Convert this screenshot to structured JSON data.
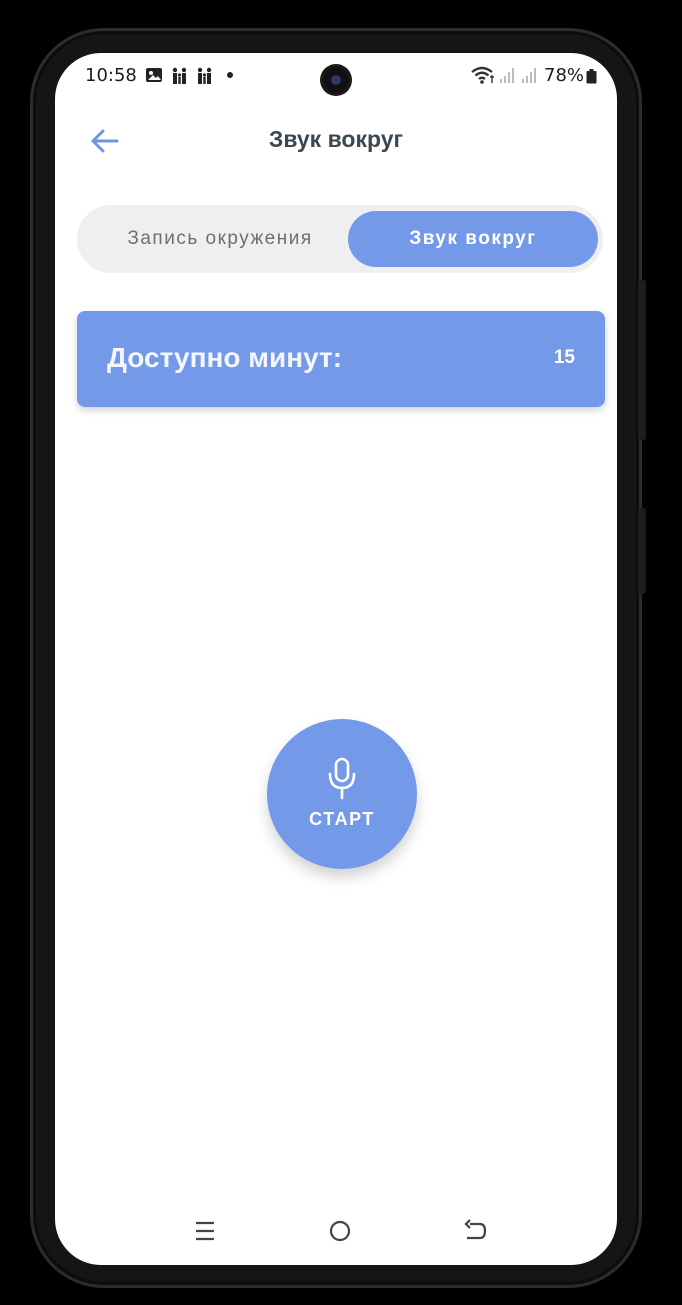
{
  "status_bar": {
    "time": "10:58",
    "battery": "78%",
    "icons": [
      "image-icon",
      "family-icon",
      "family-icon",
      "dot-icon",
      "wifi-icon",
      "signal-icon",
      "signal-icon",
      "battery-icon"
    ]
  },
  "header": {
    "title": "Звук вокруг",
    "back_icon": "arrow-left-icon"
  },
  "segmented": {
    "options": [
      {
        "label": "Запись окружения",
        "selected": false
      },
      {
        "label": "Звук вокруг",
        "selected": true
      }
    ]
  },
  "minutes_card": {
    "label": "Доступно минут:",
    "value": "15"
  },
  "start_button": {
    "label": "СТАРТ",
    "icon": "microphone-icon"
  },
  "navbar": {
    "items": [
      "recent-apps-icon",
      "home-icon",
      "back-icon"
    ]
  },
  "colors": {
    "accent": "#7399e8",
    "title": "#3b4850",
    "segment_bg": "#efefef",
    "segment_inactive_text": "#6f6f6f"
  }
}
